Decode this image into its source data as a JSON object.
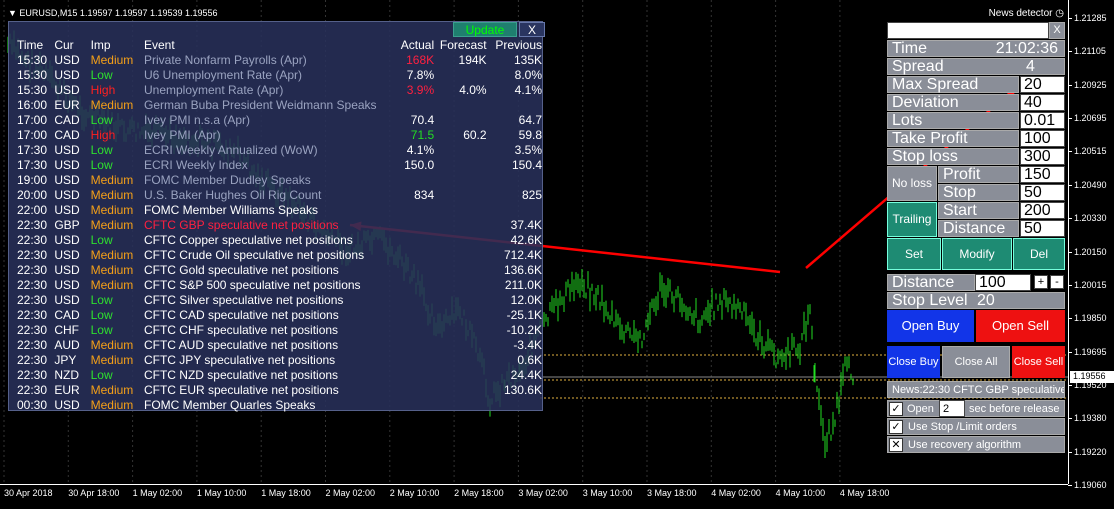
{
  "chart": {
    "symbol_info": "EURUSD,M15  1.19597 1.19597 1.19539 1.19556",
    "current_price": "1.19556",
    "price_labels": [
      "1.21285",
      "1.21105",
      "1.20925",
      "1.20695",
      "1.20515",
      "1.20490",
      "1.20330",
      "1.20150",
      "1.20015",
      "1.19850",
      "1.19695",
      "1.19520",
      "1.19380",
      "1.19220",
      "1.19060"
    ],
    "time_labels": [
      "30 Apr 2018",
      "30 Apr 18:00",
      "1 May 02:00",
      "1 May 10:00",
      "1 May 18:00",
      "2 May 02:00",
      "2 May 10:00",
      "2 May 18:00",
      "3 May 02:00",
      "3 May 10:00",
      "3 May 18:00",
      "4 May 02:00",
      "4 May 10:00",
      "4 May 18:00"
    ],
    "colors": {
      "candles": "#22dd22",
      "arrows": "#ff0000",
      "grid": "#333333"
    }
  },
  "news": {
    "update_label": "Update",
    "close_label": "X",
    "headers": {
      "time": "Time",
      "cur": "Cur",
      "imp": "Imp",
      "event": "Event",
      "actual": "Actual",
      "forecast": "Forecast",
      "previous": "Previous"
    },
    "rows": [
      {
        "time": "15:30",
        "cur": "USD",
        "imp": "Medium",
        "event": "Private Nonfarm Payrolls (Apr)",
        "actual": "168K",
        "forecast": "194K",
        "previous": "135K",
        "past": true,
        "actual_color": "red"
      },
      {
        "time": "15:30",
        "cur": "USD",
        "imp": "Low",
        "event": "U6 Unemployment Rate (Apr)",
        "actual": "7.8%",
        "forecast": "",
        "previous": "8.0%",
        "past": true
      },
      {
        "time": "15:30",
        "cur": "USD",
        "imp": "High",
        "event": "Unemployment Rate (Apr)",
        "actual": "3.9%",
        "forecast": "4.0%",
        "previous": "4.1%",
        "past": true,
        "actual_color": "red"
      },
      {
        "time": "16:00",
        "cur": "EUR",
        "imp": "Medium",
        "event": "German Buba President Weidmann Speaks",
        "actual": "",
        "forecast": "",
        "previous": "",
        "past": true
      },
      {
        "time": "17:00",
        "cur": "CAD",
        "imp": "Low",
        "event": "Ivey PMI n.s.a (Apr)",
        "actual": "70.4",
        "forecast": "",
        "previous": "64.7",
        "past": true
      },
      {
        "time": "17:00",
        "cur": "CAD",
        "imp": "High",
        "event": "Ivey PMI (Apr)",
        "actual": "71.5",
        "forecast": "60.2",
        "previous": "59.8",
        "past": true,
        "actual_color": "green"
      },
      {
        "time": "17:30",
        "cur": "USD",
        "imp": "Low",
        "event": "ECRI Weekly Annualized (WoW)",
        "actual": "4.1%",
        "forecast": "",
        "previous": "3.5%",
        "past": true
      },
      {
        "time": "17:30",
        "cur": "USD",
        "imp": "Low",
        "event": "ECRI Weekly Index",
        "actual": "150.0",
        "forecast": "",
        "previous": "150.4",
        "past": true
      },
      {
        "time": "19:00",
        "cur": "USD",
        "imp": "Medium",
        "event": "FOMC Member Dudley Speaks",
        "actual": "",
        "forecast": "",
        "previous": "",
        "past": true
      },
      {
        "time": "20:00",
        "cur": "USD",
        "imp": "Medium",
        "event": "U.S. Baker Hughes Oil Rig Count",
        "actual": "834",
        "forecast": "",
        "previous": "825",
        "past": true
      },
      {
        "time": "22:00",
        "cur": "USD",
        "imp": "Medium",
        "event": "FOMC Member Williams Speaks",
        "actual": "",
        "forecast": "",
        "previous": "",
        "past": false
      },
      {
        "time": "22:30",
        "cur": "GBP",
        "imp": "Medium",
        "event": "CFTC GBP speculative net positions",
        "actual": "",
        "forecast": "",
        "previous": "37.4K",
        "past": false,
        "event_color": "red"
      },
      {
        "time": "22:30",
        "cur": "USD",
        "imp": "Low",
        "event": "CFTC Copper speculative net positions",
        "actual": "",
        "forecast": "",
        "previous": "42.6K",
        "past": false
      },
      {
        "time": "22:30",
        "cur": "USD",
        "imp": "Medium",
        "event": "CFTC Crude Oil speculative net positions",
        "actual": "",
        "forecast": "",
        "previous": "712.4K",
        "past": false
      },
      {
        "time": "22:30",
        "cur": "USD",
        "imp": "Medium",
        "event": "CFTC Gold speculative net positions",
        "actual": "",
        "forecast": "",
        "previous": "136.6K",
        "past": false
      },
      {
        "time": "22:30",
        "cur": "USD",
        "imp": "Medium",
        "event": "CFTC S&P 500 speculative net positions",
        "actual": "",
        "forecast": "",
        "previous": "211.0K",
        "past": false
      },
      {
        "time": "22:30",
        "cur": "USD",
        "imp": "Low",
        "event": "CFTC Silver speculative net positions",
        "actual": "",
        "forecast": "",
        "previous": "12.0K",
        "past": false
      },
      {
        "time": "22:30",
        "cur": "CAD",
        "imp": "Low",
        "event": "CFTC CAD speculative net positions",
        "actual": "",
        "forecast": "",
        "previous": "-25.1K",
        "past": false
      },
      {
        "time": "22:30",
        "cur": "CHF",
        "imp": "Low",
        "event": "CFTC CHF speculative net positions",
        "actual": "",
        "forecast": "",
        "previous": "-10.2K",
        "past": false
      },
      {
        "time": "22:30",
        "cur": "AUD",
        "imp": "Medium",
        "event": "CFTC AUD speculative net positions",
        "actual": "",
        "forecast": "",
        "previous": "-3.4K",
        "past": false
      },
      {
        "time": "22:30",
        "cur": "JPY",
        "imp": "Medium",
        "event": "CFTC JPY speculative net positions",
        "actual": "",
        "forecast": "",
        "previous": "0.6K",
        "past": false
      },
      {
        "time": "22:30",
        "cur": "NZD",
        "imp": "Low",
        "event": "CFTC NZD speculative net positions",
        "actual": "",
        "forecast": "",
        "previous": "24.4K",
        "past": false
      },
      {
        "time": "22:30",
        "cur": "EUR",
        "imp": "Medium",
        "event": "CFTC EUR speculative net positions",
        "actual": "",
        "forecast": "",
        "previous": "130.6K",
        "past": false
      },
      {
        "time": "00:30",
        "cur": "USD",
        "imp": "Medium",
        "event": "FOMC Member Quarles Speaks",
        "actual": "",
        "forecast": "",
        "previous": "",
        "past": false
      }
    ]
  },
  "panel": {
    "title": "News detector",
    "close_label": "X",
    "time_label": "Time",
    "time_value": "21:02:36",
    "spread_label": "Spread",
    "spread_value": "4",
    "max_spread_label": "Max Spread",
    "max_spread_value": "20",
    "deviation_label": "Deviation",
    "deviation_value": "40",
    "lots_label": "Lots",
    "lots_value": "0.01",
    "take_profit_label": "Take Profit",
    "take_profit_value": "100",
    "stop_loss_label": "Stop loss",
    "stop_loss_value": "300",
    "no_loss_label": "No loss",
    "nl_profit_label": "Profit",
    "nl_profit_value": "150",
    "nl_stop_label": "Stop",
    "nl_stop_value": "50",
    "trailing_label": "Trailing",
    "tr_start_label": "Start",
    "tr_start_value": "200",
    "tr_distance_label": "Distance",
    "tr_distance_value": "50",
    "set_label": "Set",
    "modify_label": "Modify",
    "del_label": "Del",
    "distance_label": "Distance",
    "distance_value": "100",
    "plus_label": "+",
    "minus_label": "-",
    "stop_level_label": "Stop Level",
    "stop_level_value": "20",
    "open_buy_label": "Open Buy",
    "open_sell_label": "Open Sell",
    "close_buy_label": "Close Buy",
    "close_all_label": "Close All",
    "close_sell_label": "Close Sell",
    "news_line": "News:22:30 CFTC GBP speculative",
    "open_label": "Open",
    "open_value": "2",
    "sec_before_label": "sec before release",
    "use_stop_limit_label": "Use Stop /Limit orders",
    "use_recovery_label": "Use recovery algorithm",
    "check_mark": "✓",
    "cross_mark": "✕"
  }
}
